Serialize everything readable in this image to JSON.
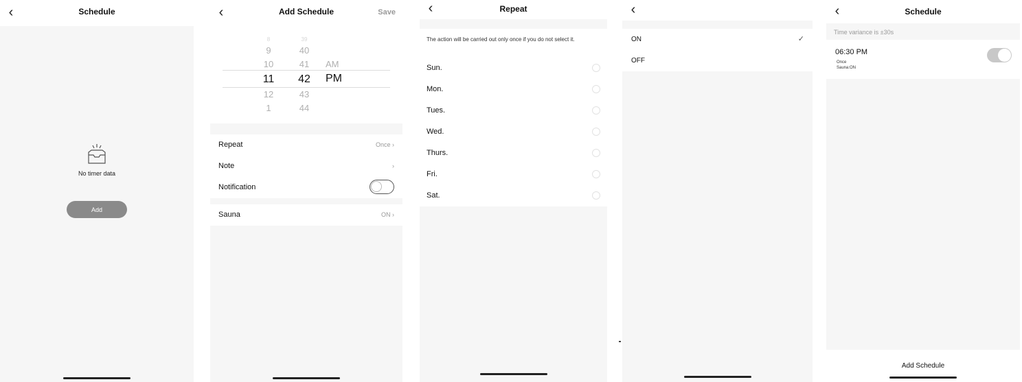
{
  "icons": {
    "back": "chevron-left",
    "chevron": "chevron-right",
    "check": "checkmark",
    "empty": "empty-tray"
  },
  "screen1": {
    "title": "Schedule",
    "empty_text": "No timer data",
    "add_label": "Add"
  },
  "screen2": {
    "title": "Add Schedule",
    "save_label": "Save",
    "picker": {
      "hours_above": [
        "9",
        "10"
      ],
      "hour_selected": "11",
      "hours_below": [
        "12",
        "1"
      ],
      "minutes_above": [
        "40",
        "41"
      ],
      "minute_selected": "42",
      "minutes_below": [
        "43",
        "44"
      ],
      "am": "AM",
      "pm": "PM",
      "selected_period": "PM"
    },
    "repeat_label": "Repeat",
    "repeat_value": "Once",
    "note_label": "Note",
    "notification_label": "Notification",
    "notification_on": false,
    "sauna_label": "Sauna",
    "sauna_value": "ON"
  },
  "screen3": {
    "title": "Repeat",
    "note": "The action will be carried out only once if you do not select it.",
    "days": [
      "Sun.",
      "Mon.",
      "Tues.",
      "Wed.",
      "Thurs.",
      "Fri.",
      "Sat."
    ]
  },
  "screen4": {
    "options": [
      {
        "label": "ON",
        "selected": true
      },
      {
        "label": "OFF",
        "selected": false
      }
    ]
  },
  "screen5": {
    "title": "Schedule",
    "variance": "Time variance is  ±30s",
    "item": {
      "time": "06:30 PM",
      "repeat": "Once",
      "action": "Sauna:ON",
      "enabled": true
    },
    "add_label": "Add Schedule"
  },
  "colors": {
    "background": "#f6f6f6",
    "button_gray": "#8a8a8a",
    "toggle_on": "#c8c8c8"
  }
}
